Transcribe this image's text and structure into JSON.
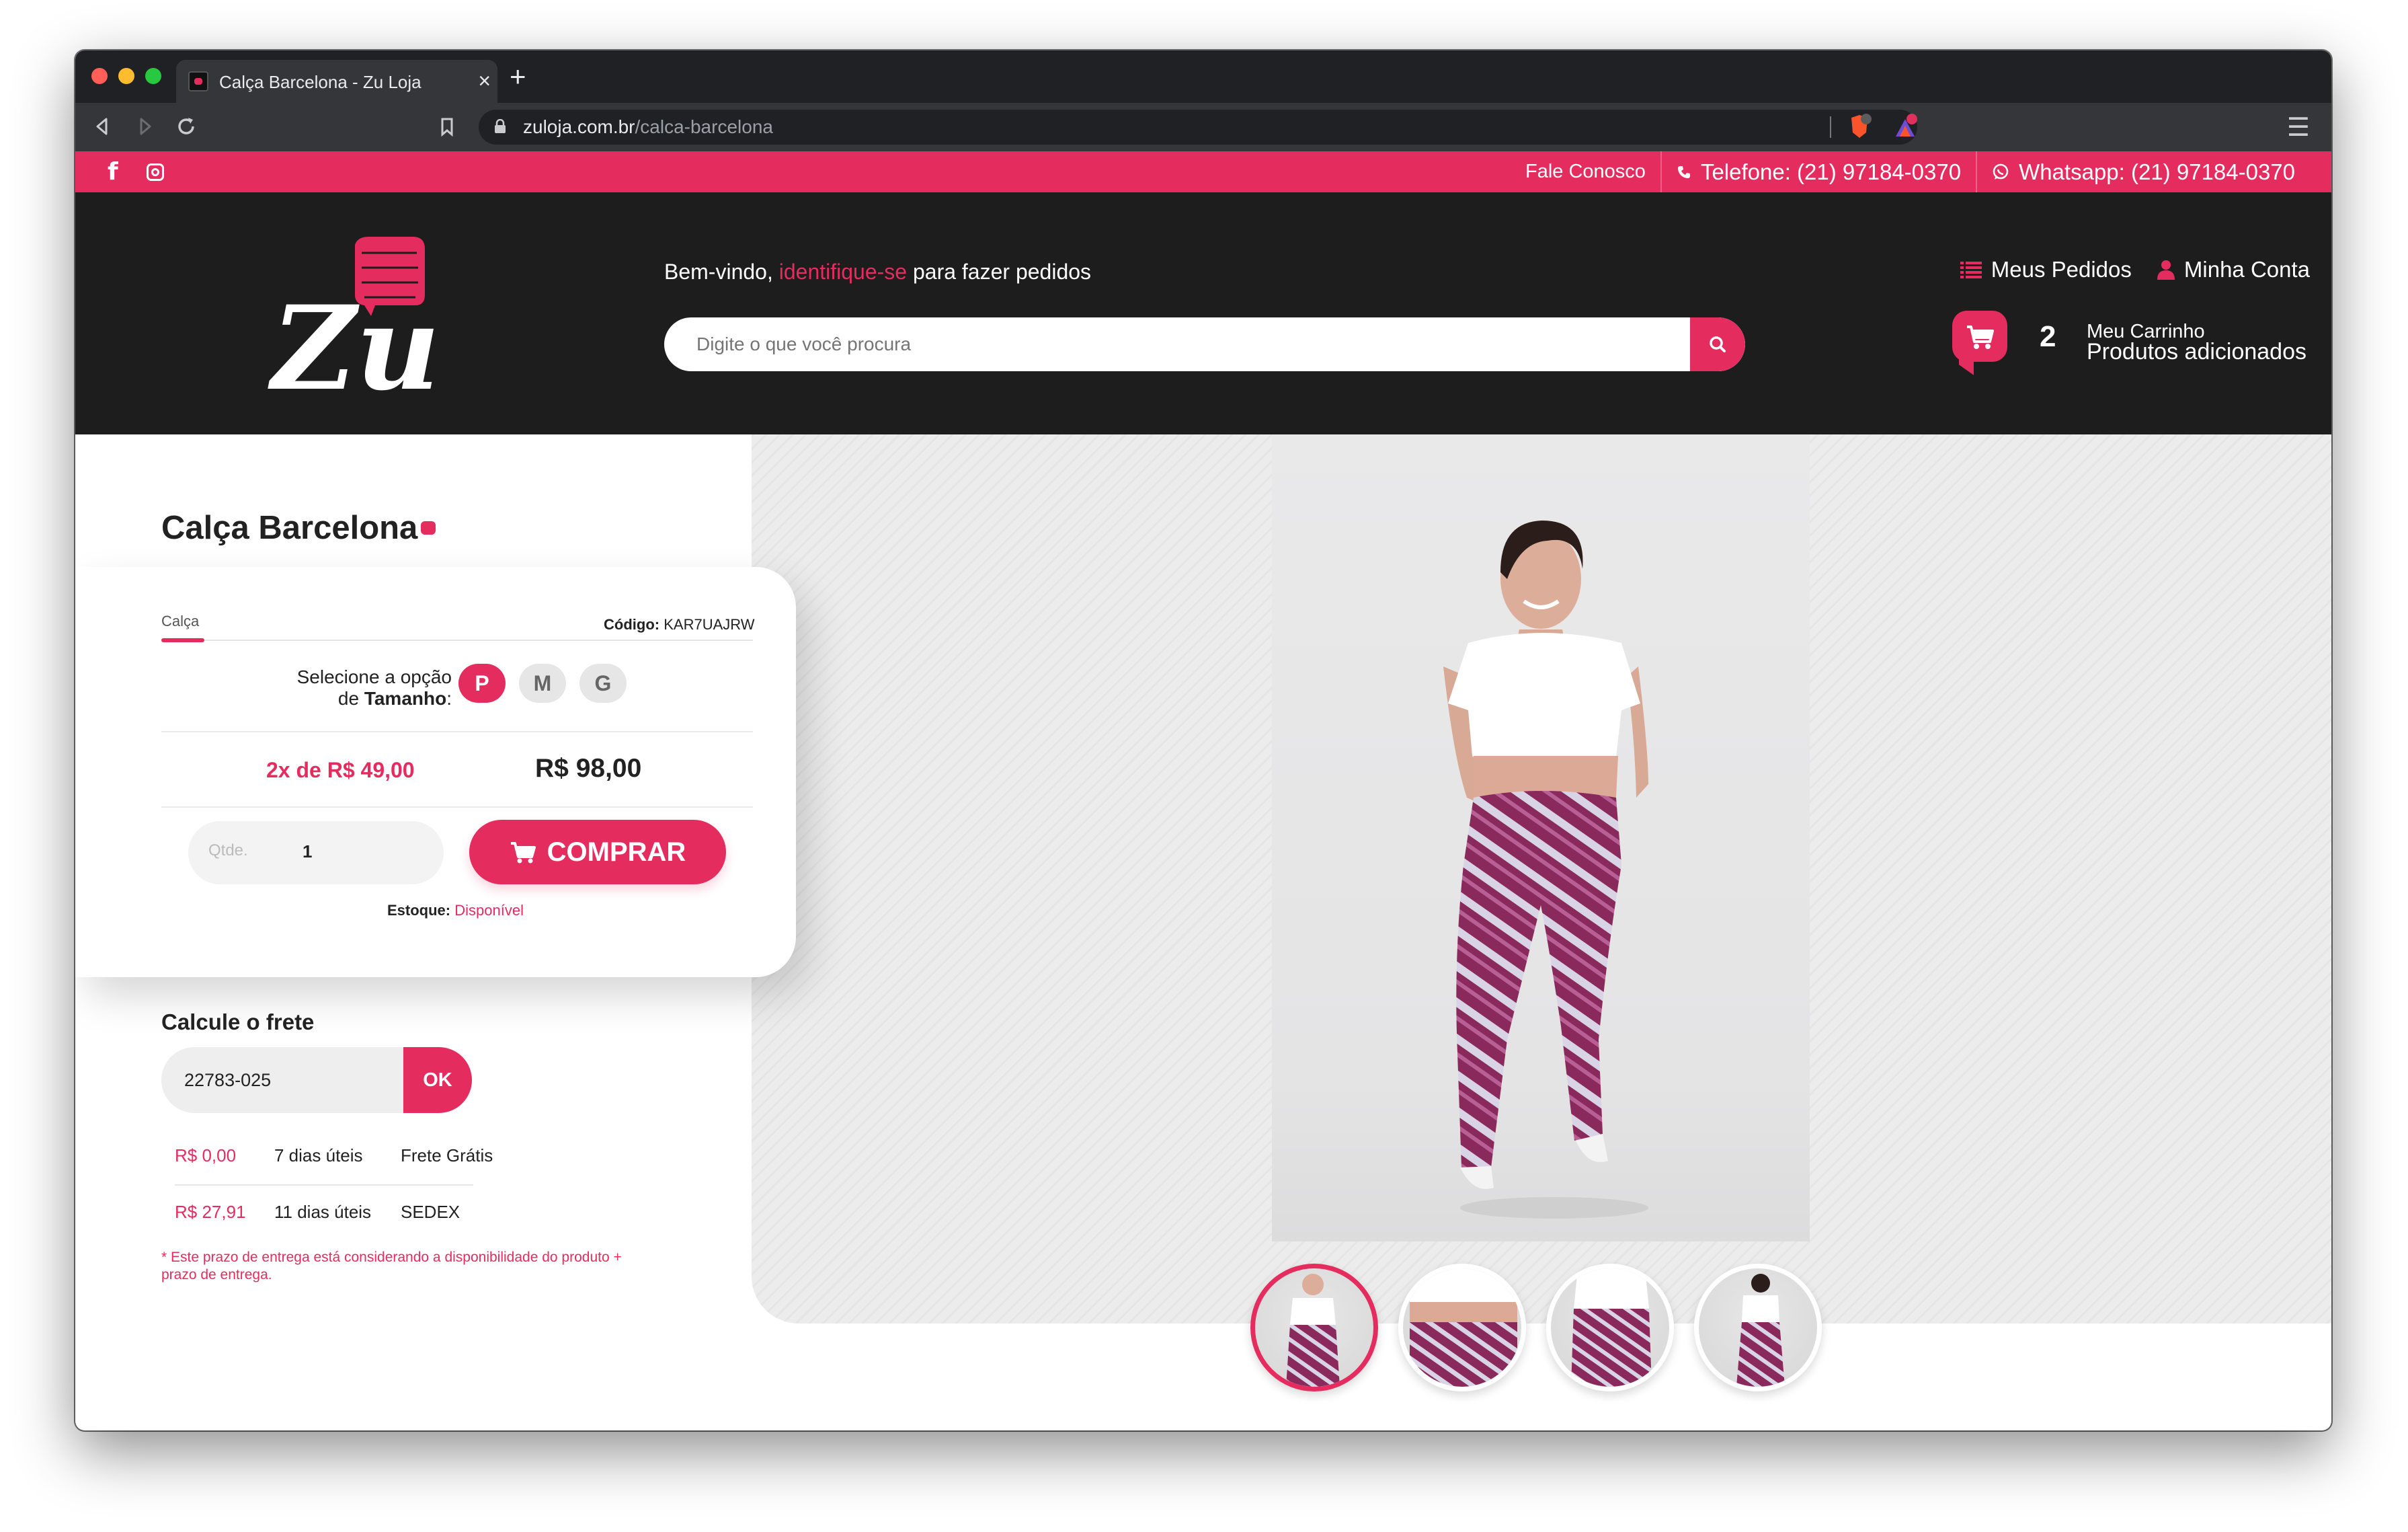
{
  "browser": {
    "tab_title": "Calça Barcelona - Zu Loja",
    "url_host": "zuloja.com.br",
    "url_path": "/calca-barcelona",
    "colors": {
      "close": "#ff5f57",
      "minimize": "#febc2e",
      "zoom": "#28c840"
    }
  },
  "topbar": {
    "contact": "Fale Conosco",
    "phone": "Telefone: (21) 97184-0370",
    "whatsapp": "Whatsapp: (21) 97184-0370",
    "facebook_icon": "f"
  },
  "header": {
    "welcome_pre": "Bem-vindo, ",
    "welcome_link": "identifique-se",
    "welcome_post": " para fazer pedidos",
    "search_placeholder": "Digite o que você procura",
    "orders": "Meus Pedidos",
    "account": "Minha Conta",
    "cart_count": "2",
    "cart_title": "Meu Carrinho",
    "cart_subtitle": "Produtos adicionados"
  },
  "product": {
    "title": "Calça Barcelona",
    "category": "Calça",
    "code_label": "Código:",
    "code": "KAR7UAJRW",
    "option_pre": "Selecione a opção de ",
    "option_name": "Tamanho",
    "option_post": ":",
    "sizes": [
      "P",
      "M",
      "G"
    ],
    "selected_size": "P",
    "installments": "2x de R$ 49,00",
    "price": "R$ 98,00",
    "qty_label": "Qtde.",
    "qty_value": "1",
    "buy_label": "COMPRAR",
    "stock_label": "Estoque:",
    "stock_value": "Disponível"
  },
  "shipping": {
    "title": "Calcule o frete",
    "cep_value": "22783-025",
    "ok_label": "OK",
    "options": [
      {
        "price": "R$ 0,00",
        "days": "7 dias úteis",
        "method": "Frete Grátis"
      },
      {
        "price": "R$ 27,91",
        "days": "11 dias úteis",
        "method": "SEDEX"
      }
    ],
    "note": "* Este prazo de entrega está considerando a disponibilidade do produto + prazo de entrega."
  },
  "brand": {
    "accent": "#e52c5f",
    "dark": "#1d1d1d"
  }
}
